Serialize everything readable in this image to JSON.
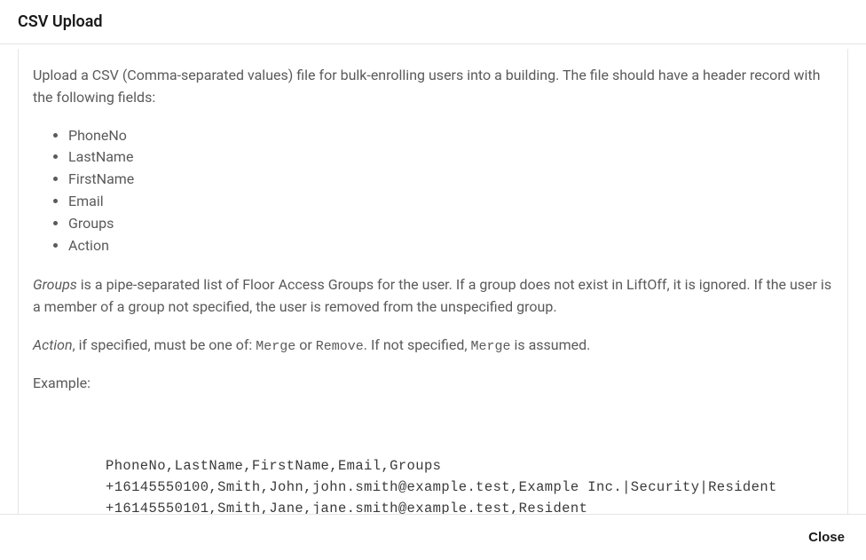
{
  "header": {
    "title": "CSV Upload"
  },
  "intro": "Upload a CSV (Comma-separated values) file for bulk-enrolling users into a building. The file should have a header record with the following fields:",
  "fields": [
    "PhoneNo",
    "LastName",
    "FirstName",
    "Email",
    "Groups",
    "Action"
  ],
  "groups_note": {
    "emph": "Groups",
    "rest": " is a pipe-separated list of Floor Access Groups for the user. If a group does not exist in LiftOff, it is ignored. If the user is a member of a group not specified, the user is removed from the unspecified group."
  },
  "action_note": {
    "emph": "Action",
    "part1": ", if specified, must be one of: ",
    "code1": "Merge",
    "mid": " or ",
    "code2": "Remove",
    "part2": ". If not specified, ",
    "code3": "Merge",
    "part3": " is assumed."
  },
  "example_label": "Example:",
  "example_code": "PhoneNo,LastName,FirstName,Email,Groups\n+16145550100,Smith,John,john.smith@example.test,Example Inc.|Security|Resident\n+16145550101,Smith,Jane,jane.smith@example.test,Resident",
  "footer": {
    "close_label": "Close"
  }
}
